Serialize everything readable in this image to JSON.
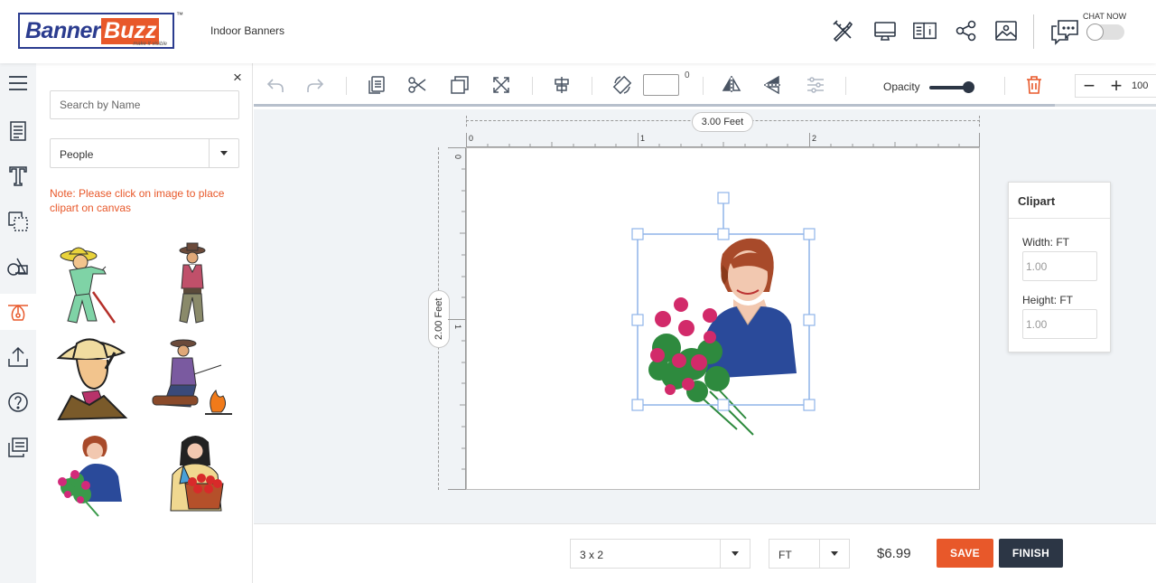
{
  "header": {
    "logo_banner": "Banner",
    "logo_buzz": "Buzz",
    "logo_tagline": "make it visible",
    "logo_tm": "™",
    "page_title": "Indoor Banners",
    "chat_label": "CHAT NOW",
    "icons": [
      "design-tools-icon",
      "desktop-preview-icon",
      "product-info-icon",
      "share-icon",
      "image-icon",
      "chat-icon"
    ]
  },
  "rail": {
    "items": [
      "menu-icon",
      "template-icon",
      "text-icon",
      "background-icon",
      "shapes-icon",
      "clipart-icon",
      "upload-icon",
      "help-icon",
      "layers-icon"
    ],
    "active": "clipart-icon"
  },
  "panel": {
    "close": "×",
    "search_placeholder": "Search by Name",
    "category": "People",
    "note": "Note: Please click on image to place clipart on canvas"
  },
  "toolbar": {
    "opacity_label": "Opacity",
    "rotation_value": "",
    "degree_symbol": "0",
    "zoom_minus": "−",
    "zoom_plus": "+",
    "zoom_value": "100"
  },
  "canvas": {
    "width_label": "3.00 Feet",
    "height_label": "2.00 Feet",
    "h_ticks": [
      "0",
      "1",
      "2"
    ],
    "v_ticks": [
      "0",
      "1"
    ]
  },
  "properties": {
    "title": "Clipart",
    "width_label": "Width: FT",
    "width_value": "1.00",
    "height_label": "Height: FT",
    "height_value": "1.00"
  },
  "bottom": {
    "size": "3 x 2",
    "unit": "FT",
    "price": "$6.99",
    "save": "SAVE",
    "finish": "FINISH"
  },
  "colors": {
    "accent": "#e8582a",
    "brand_blue": "#2b3c8f",
    "dark": "#2c3645",
    "selection": "#8fb4e8"
  }
}
